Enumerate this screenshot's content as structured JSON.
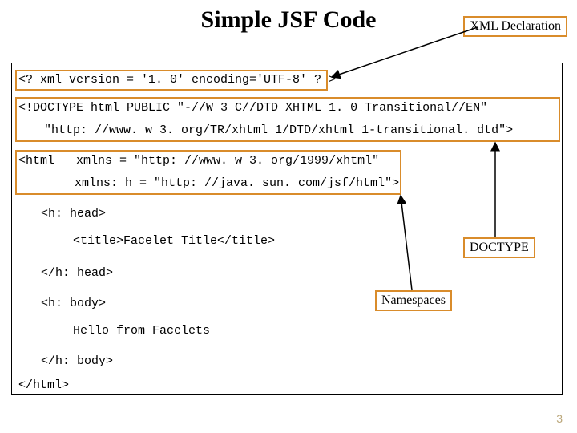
{
  "title": "Simple JSF Code",
  "callouts": {
    "xml_decl": "XML Declaration",
    "doctype": "DOCTYPE",
    "namespaces": "Namespaces"
  },
  "code": {
    "l1": "<? xml version = '1. 0' encoding='UTF-8' ? >",
    "l2": "<!DOCTYPE html PUBLIC \"-//W 3 C//DTD XHTML 1. 0 Transitional//EN\"",
    "l3": "\"http: //www. w 3. org/TR/xhtml 1/DTD/xhtml 1-transitional. dtd\">",
    "l4": "<html   xmlns = \"http: //www. w 3. org/1999/xhtml\"",
    "l5": "xmlns: h = \"http: //java. sun. com/jsf/html\">",
    "l6": "<h: head>",
    "l7": "<title>Facelet Title</title>",
    "l8": "</h: head>",
    "l9": "<h: body>",
    "l10": "Hello from Facelets",
    "l11": "</h: body>",
    "l12": "</html>"
  },
  "page_number": "3"
}
